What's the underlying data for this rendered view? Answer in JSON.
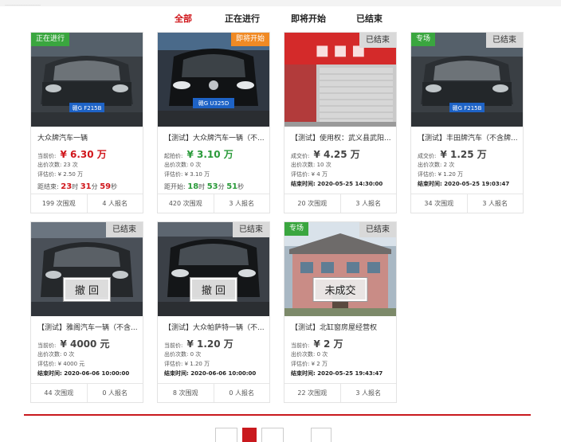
{
  "header": {
    "faint_text": "_______________"
  },
  "tabs": [
    {
      "label": "全部",
      "active": true
    },
    {
      "label": "正在进行",
      "active": false
    },
    {
      "label": "即将开始",
      "active": false
    },
    {
      "label": "已结束",
      "active": false
    }
  ],
  "cards": [
    {
      "badge_left": "正在进行",
      "badge_left_color": "green",
      "badge_right": "",
      "plate": "赣G F215B",
      "stamp": "",
      "title": "大众牌汽车一辆",
      "price_label": "当前价:",
      "price": "¥ 6.30 万",
      "price_style": "red",
      "meta1": "出价次数: 23 次",
      "meta2": "评估价: ¥ 2.50 万",
      "count_label": "距结束:",
      "count": [
        "23",
        "时",
        "31",
        "分",
        "59",
        "秒"
      ],
      "count_style": "red",
      "views": "199 次围观",
      "signups": "4 人报名"
    },
    {
      "badge_left": "",
      "badge_right": "即将开始",
      "badge_right_color": "orange",
      "plate": "赣G U325D",
      "stamp": "",
      "title": "【测试】大众牌汽车一辆（不...",
      "price_label": "起拍价:",
      "price": "¥ 3.10 万",
      "price_style": "green",
      "meta1": "出价次数: 0 次",
      "meta2": "评估价: ¥ 3.10 万",
      "count_label": "距开始:",
      "count": [
        "18",
        "时",
        "53",
        "分",
        "51",
        "秒"
      ],
      "count_style": "green",
      "views": "420 次围观",
      "signups": "3 人报名"
    },
    {
      "badge_left": "",
      "badge_right": "已结束",
      "badge_right_color": "gray",
      "plate": "",
      "stamp": "",
      "title": "【测试】使用权：武义县武阳...",
      "price_label": "成交价:",
      "price": "¥ 4.25 万",
      "price_style": "dark",
      "meta1": "出价次数: 10 次",
      "meta2": "评估价: ¥ 4 万",
      "end_label": "结束时间:",
      "end_time": "2020-05-25 14:30:00",
      "views": "20 次围观",
      "signups": "3 人报名"
    },
    {
      "badge_left": "专场",
      "badge_left_color": "green",
      "badge_right": "已结束",
      "badge_right_color": "gray",
      "plate": "赣G F215B",
      "stamp": "",
      "title": "【测试】丰田牌汽车（不含牌...",
      "price_label": "成交价:",
      "price": "¥ 1.25 万",
      "price_style": "dark",
      "meta1": "出价次数: 2 次",
      "meta2": "评估价: ¥ 1.20 万",
      "end_label": "结束时间:",
      "end_time": "2020-05-25 19:03:47",
      "views": "34 次围观",
      "signups": "3 人报名"
    },
    {
      "badge_left": "",
      "badge_right": "已结束",
      "badge_right_color": "gray",
      "plate": "",
      "stamp": "撤 回",
      "title": "【测试】雅阁汽车一辆（不含...",
      "price_label": "当前价:",
      "price": "¥ 4000 元",
      "price_style": "dark",
      "meta1": "出价次数: 0 次",
      "meta2": "评估价: ¥ 4000 元",
      "end_label": "结束时间:",
      "end_time": "2020-06-06 10:00:00",
      "views": "44 次围观",
      "signups": "0 人报名"
    },
    {
      "badge_left": "",
      "badge_right": "已结束",
      "badge_right_color": "gray",
      "plate": "",
      "stamp": "撤 回",
      "title": "【测试】大众帕萨特一辆（不...",
      "price_label": "当前价:",
      "price": "¥ 1.20 万",
      "price_style": "dark",
      "meta1": "出价次数: 0 次",
      "meta2": "评估价: ¥ 1.20 万",
      "end_label": "结束时间:",
      "end_time": "2020-06-06 10:00:00",
      "views": "8 次围观",
      "signups": "0 人报名"
    },
    {
      "badge_left": "专场",
      "badge_left_color": "green",
      "badge_right": "已结束",
      "badge_right_color": "gray",
      "plate": "",
      "stamp": "未成交",
      "title": "【测试】北缸窗房屋经营权",
      "price_label": "当前价:",
      "price": "¥ 2 万",
      "price_style": "dark",
      "meta1": "出价次数: 0 次",
      "meta2": "评估价: ¥ 2 万",
      "end_label": "结束时间:",
      "end_time": "2020-05-25 19:43:47",
      "views": "22 次围观",
      "signups": "3 人报名"
    }
  ],
  "pagination": {
    "current_page": 2
  },
  "colors": {
    "accent": "#c9191e",
    "green": "#3aa63f",
    "orange": "#f08a24",
    "gray_badge": "#d9d9d9"
  }
}
